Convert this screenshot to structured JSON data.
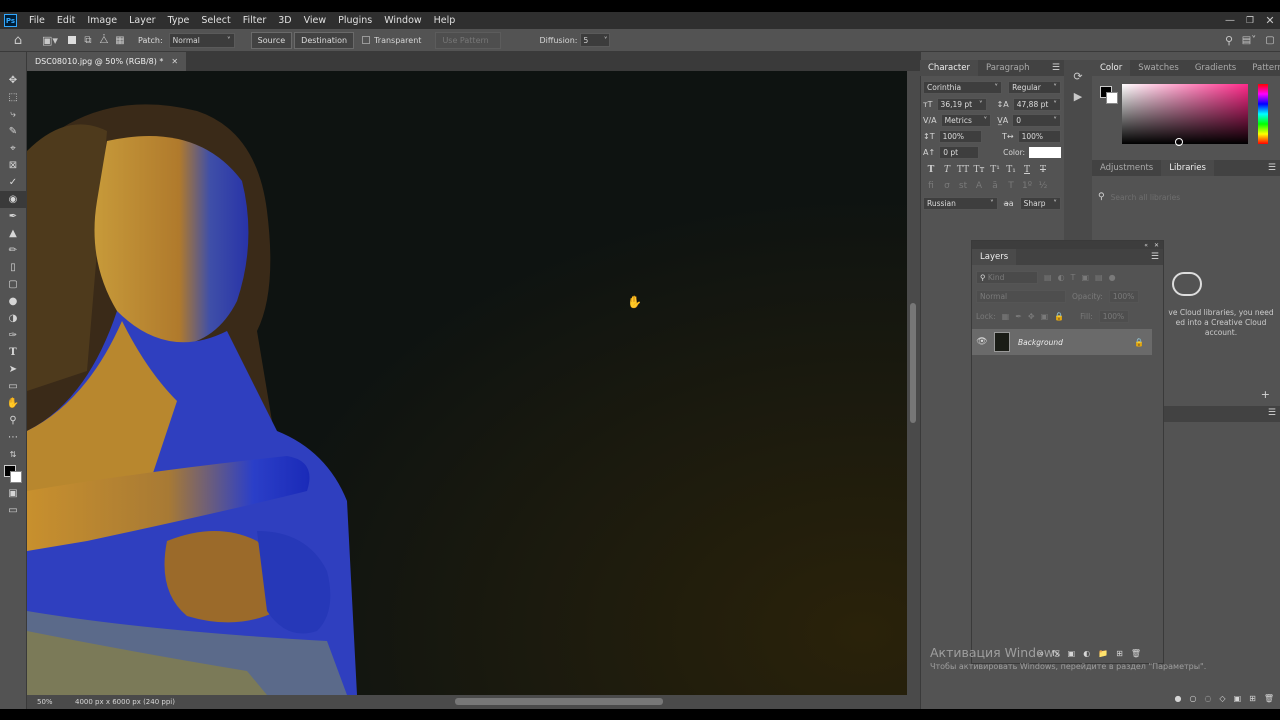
{
  "app": {
    "logo": "Ps"
  },
  "menu": [
    "File",
    "Edit",
    "Image",
    "Layer",
    "Type",
    "Select",
    "Filter",
    "3D",
    "View",
    "Plugins",
    "Window",
    "Help"
  ],
  "options_bar": {
    "patch_label": "Patch:",
    "patch_value": "Normal",
    "source": "Source",
    "destination": "Destination",
    "transparent": "Transparent",
    "use_pattern": "Use Pattern",
    "diffusion_label": "Diffusion:",
    "diffusion_value": "5"
  },
  "document": {
    "tab_title": "DSC08010.jpg @ 50% (RGB/8) *"
  },
  "status": {
    "zoom": "50%",
    "info": "4000 px x 6000 px (240 ppi)"
  },
  "character": {
    "tabs": [
      "Character",
      "Paragraph"
    ],
    "font_family": "Corinthia",
    "font_style": "Regular",
    "size": "36,19 pt",
    "leading": "47,88 pt",
    "kerning": "Metrics",
    "tracking": "0",
    "vscale": "100%",
    "hscale": "100%",
    "baseline": "0 pt",
    "color_label": "Color:",
    "language": "Russian",
    "antialias": "Sharp"
  },
  "color_panel": {
    "tabs": [
      "Color",
      "Swatches",
      "Gradients",
      "Patterns"
    ]
  },
  "adj_panel": {
    "tabs": [
      "Adjustments",
      "Libraries"
    ],
    "search_placeholder": "Search all libraries",
    "msg_line1": "ve Cloud libraries, you need",
    "msg_line2": "ed into a Creative Cloud",
    "msg_line3": "account."
  },
  "layers": {
    "title": "Layers",
    "kind": "Kind",
    "blend": "Normal",
    "opacity_label": "Opacity:",
    "opacity_value": "100%",
    "lock_label": "Lock:",
    "fill_label": "Fill:",
    "fill_value": "100%",
    "layer_name": "Background"
  },
  "watermark": {
    "line1": "Активация Windows",
    "line2": "Чтобы активировать Windows, перейдите в раздел \"Параметры\"."
  },
  "colors": {
    "ui_bg": "#535353",
    "panel_bg": "#535353",
    "dark_bar": "#323232",
    "accent": "#31a8ff"
  }
}
